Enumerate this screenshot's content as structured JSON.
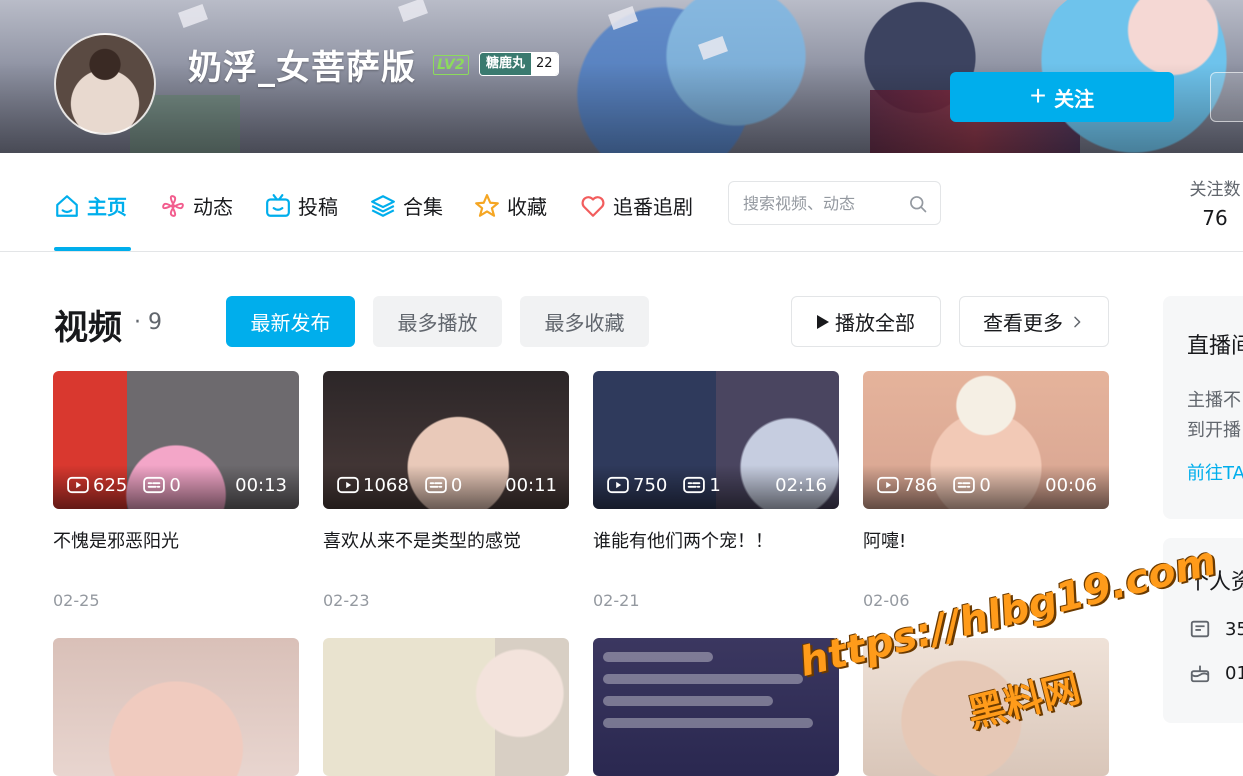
{
  "profile": {
    "username": "奶浮_女菩萨版",
    "level": "LV2",
    "medal_name": "糖鹿丸",
    "medal_level": "22",
    "follow_label": "关注"
  },
  "nav": {
    "items": [
      {
        "label": "主页",
        "icon": "home-icon",
        "active": true
      },
      {
        "label": "动态",
        "icon": "pinwheel-icon",
        "active": false
      },
      {
        "label": "投稿",
        "icon": "tv-icon",
        "active": false
      },
      {
        "label": "合集",
        "icon": "layers-icon",
        "active": false
      },
      {
        "label": "收藏",
        "icon": "star-icon",
        "active": false
      },
      {
        "label": "追番追剧",
        "icon": "heart-icon",
        "active": false
      }
    ],
    "search_placeholder": "搜索视频、动态",
    "following_label": "关注数",
    "following_count": "76"
  },
  "videos_section": {
    "title": "视频",
    "count": "· 9",
    "tabs": [
      "最新发布",
      "最多播放",
      "最多收藏"
    ],
    "play_all": "播放全部",
    "see_more": "查看更多"
  },
  "videos": [
    {
      "title": "不愧是邪恶阳光",
      "views": "625",
      "danmaku": "0",
      "duration": "00:13",
      "date": "02-25"
    },
    {
      "title": "喜欢从来不是类型的感觉",
      "views": "1068",
      "danmaku": "0",
      "duration": "00:11",
      "date": "02-23"
    },
    {
      "title": "谁能有他们两个宠！！",
      "views": "750",
      "danmaku": "1",
      "duration": "02:16",
      "date": "02-21"
    },
    {
      "title": "阿嚏!",
      "views": "786",
      "danmaku": "0",
      "duration": "00:06",
      "date": "02-06"
    }
  ],
  "sidebar": {
    "live_title": "直播间",
    "live_text_1": "主播不",
    "live_text_2": "到开播",
    "live_link": "前往TA",
    "info_title": "个人资",
    "info_row_1": "35",
    "info_row_2": "01"
  },
  "watermark": {
    "url": "https://hlbg19.com",
    "name": "黑料网"
  },
  "colors": {
    "accent": "#00aeec",
    "level_green": "#8cdb5c",
    "watermark_orange": "#ff9b1a"
  }
}
